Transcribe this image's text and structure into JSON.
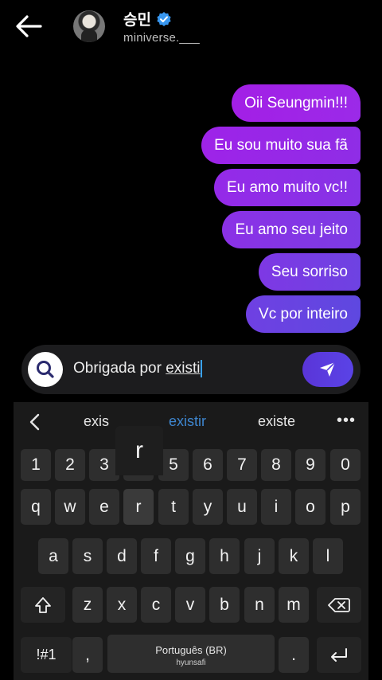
{
  "header": {
    "name": "승민",
    "handle": "miniverse.___"
  },
  "messages": [
    "Oii Seungmin!!!",
    "Eu sou muito sua fã",
    "Eu amo muito vc!!",
    "Eu amo seu jeito",
    "Seu sorriso",
    "Vc por inteiro"
  ],
  "composer": {
    "text_prefix": "Obrigada por ",
    "text_word": "existi"
  },
  "keyboard": {
    "suggestions": [
      "exis",
      "existir",
      "existe"
    ],
    "more": "•••",
    "popup_key": "r",
    "number_row": [
      "1",
      "2",
      "3",
      "4",
      "5",
      "6",
      "7",
      "8",
      "9",
      "0"
    ],
    "row1": [
      "q",
      "w",
      "e",
      "r",
      "t",
      "y",
      "u",
      "i",
      "o",
      "p"
    ],
    "row2": [
      "a",
      "s",
      "d",
      "f",
      "g",
      "h",
      "j",
      "k",
      "l"
    ],
    "row3": [
      "z",
      "x",
      "c",
      "v",
      "b",
      "n",
      "m"
    ],
    "symbols_label": "!#1",
    "comma": ",",
    "period": ".",
    "space_label": "Português (BR)",
    "watermark": "hyunsafi"
  },
  "colors": {
    "bubble_start": "#a31fe6",
    "bubble_end": "#5e48e0",
    "suggestion_active": "#3e86cf",
    "send_button": "#5a43e6",
    "verified": "#3897f0"
  },
  "icons": {
    "back": "arrow-left-icon",
    "verified": "verified-badge-icon",
    "search": "search-icon",
    "send": "send-icon",
    "chevron": "chevron-left-icon",
    "shift": "shift-icon",
    "backspace": "backspace-icon",
    "enter": "enter-icon"
  }
}
